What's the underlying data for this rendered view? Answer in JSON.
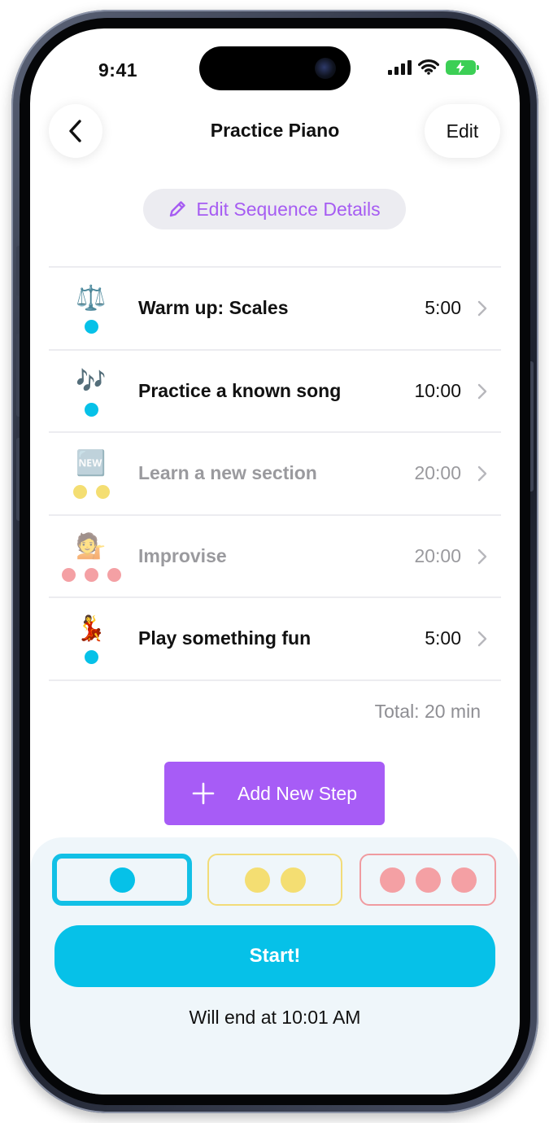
{
  "status_bar": {
    "time": "9:41"
  },
  "nav": {
    "title": "Practice Piano",
    "edit_label": "Edit"
  },
  "details": {
    "label": "Edit Sequence Details"
  },
  "steps": [
    {
      "name": "Warm up: Scales",
      "duration": "5:00",
      "emoji": "⚖️",
      "level": 1,
      "dimmed": false
    },
    {
      "name": "Practice a known song",
      "duration": "10:00",
      "emoji": "🎶",
      "level": 1,
      "dimmed": false
    },
    {
      "name": "Learn a new section",
      "duration": "20:00",
      "emoji": "🆕",
      "level": 2,
      "dimmed": true
    },
    {
      "name": "Improvise",
      "duration": "20:00",
      "emoji": "💁",
      "level": 3,
      "dimmed": true
    },
    {
      "name": "Play something fun",
      "duration": "5:00",
      "emoji": "💃",
      "level": 1,
      "dimmed": false
    }
  ],
  "summary": {
    "total": "Total: 20 min"
  },
  "add_step": {
    "label": "Add New Step"
  },
  "levels": {
    "selected": 1,
    "options": [
      1,
      2,
      3
    ]
  },
  "start": {
    "label": "Start!",
    "end_text": "Will end at 10:01 AM"
  },
  "colors": {
    "accent_purple": "#a75cf6",
    "level1_blue": "#06c1e8",
    "level2_yellow": "#f4de72",
    "level3_pink": "#f4a0a4"
  }
}
